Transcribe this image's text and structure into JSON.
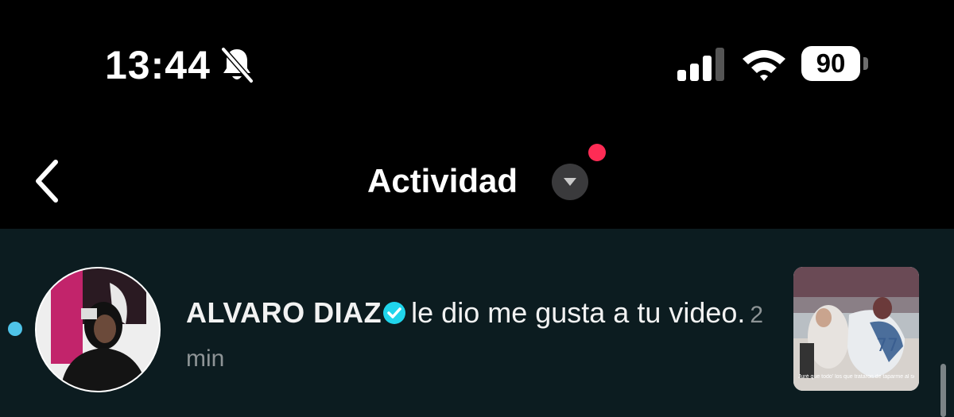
{
  "status_bar": {
    "time": "13:44",
    "battery_level": "90",
    "icons": [
      "bell-muted-icon",
      "signal-icon",
      "wifi-icon",
      "battery-icon"
    ]
  },
  "header": {
    "title": "Actividad",
    "back_icon": "chevron-left-icon",
    "dropdown_icon": "caret-down-icon",
    "notification_color": "#fe2c55"
  },
  "activity": {
    "items": [
      {
        "user": "ALVARO DIAZ",
        "verified": true,
        "action": "le dio me gusta a tu video.",
        "time": "2 min",
        "unread": true,
        "thumbnail_caption": "Juré que todo' los que trataron de taparme al sol"
      }
    ]
  },
  "colors": {
    "background": "#000000",
    "list_background": "#0c1c20",
    "unread_dot": "#4fc3e8",
    "verified_badge": "#20d5ec"
  }
}
